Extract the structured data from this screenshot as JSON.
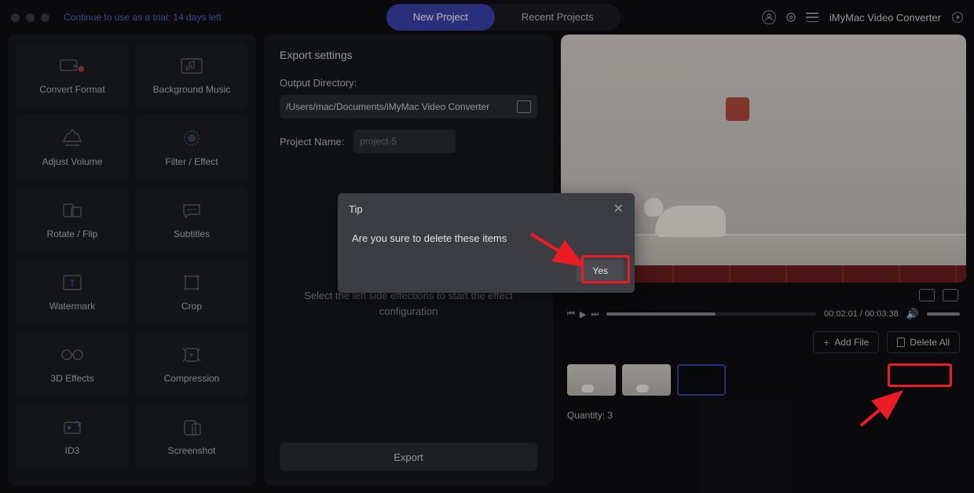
{
  "trial_text": "Continue to use as a trial: 14 days left",
  "tabs": {
    "new_project": "New Project",
    "recent_projects": "Recent Projects"
  },
  "app_name": "iMyMac Video Converter",
  "tools": [
    {
      "id": "convert-format",
      "label": "Convert Format"
    },
    {
      "id": "background-music",
      "label": "Background Music"
    },
    {
      "id": "adjust-volume",
      "label": "Adjust Volume"
    },
    {
      "id": "filter-effect",
      "label": "Filter / Effect"
    },
    {
      "id": "rotate-flip",
      "label": "Rotate / Flip"
    },
    {
      "id": "subtitles",
      "label": "Subtitles"
    },
    {
      "id": "watermark",
      "label": "Watermark"
    },
    {
      "id": "crop",
      "label": "Crop"
    },
    {
      "id": "3d-effects",
      "label": "3D Effects"
    },
    {
      "id": "compression",
      "label": "Compression"
    },
    {
      "id": "id3",
      "label": "ID3"
    },
    {
      "id": "screenshot",
      "label": "Screenshot"
    }
  ],
  "export": {
    "heading": "Export settings",
    "output_label": "Output Directory:",
    "output_value": "/Users/mac/Documents/iMyMac Video Converter",
    "project_label": "Project Name:",
    "project_placeholder": "project-5",
    "help_text_line1": "Select the left side effections to start the effect",
    "help_text_line2": "configuration",
    "export_btn": "Export"
  },
  "player": {
    "time": "00:02:01 / 00:03:38"
  },
  "actions": {
    "add_file": "Add File",
    "delete_all": "Delete All"
  },
  "quantity_label": "Quantity: 3",
  "modal": {
    "title": "Tip",
    "message": "Are you sure to delete these items",
    "yes": "Yes"
  }
}
